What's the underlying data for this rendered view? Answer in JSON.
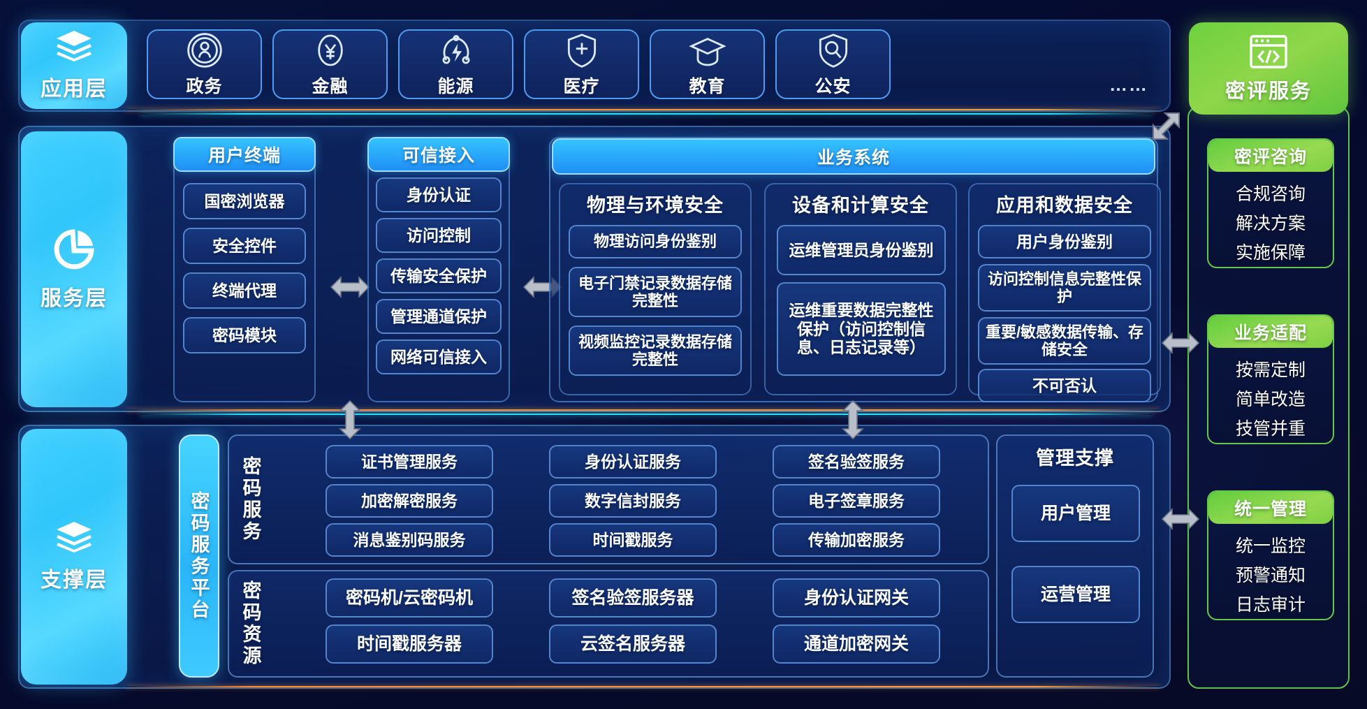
{
  "layers": {
    "application": {
      "label": "应用层",
      "icon": "layers-icon"
    },
    "service": {
      "label": "服务层",
      "icon": "pie-chart-icon"
    },
    "support": {
      "label": "支撑层",
      "icon": "layers-stack-icon"
    }
  },
  "application_layer": {
    "tiles": [
      {
        "label": "政务",
        "icon": "government-person-icon"
      },
      {
        "label": "金融",
        "icon": "finance-yuan-icon"
      },
      {
        "label": "能源",
        "icon": "energy-bolt-icon"
      },
      {
        "label": "医疗",
        "icon": "medical-shield-plus-icon"
      },
      {
        "label": "教育",
        "icon": "education-cap-icon"
      },
      {
        "label": "公安",
        "icon": "police-shield-search-icon"
      }
    ],
    "more": "……"
  },
  "service_layer": {
    "user_terminal": {
      "title": "用户终端",
      "items": [
        "国密浏览器",
        "安全控件",
        "终端代理",
        "密码模块"
      ]
    },
    "trusted_access": {
      "title": "可信接入",
      "items": [
        "身份认证",
        "访问控制",
        "传输安全保护",
        "管理通道保护",
        "网络可信接入"
      ]
    },
    "business_system": {
      "title": "业务系统",
      "columns": [
        {
          "title": "物理与环境安全",
          "items": [
            "物理访问身份鉴别",
            "电子门禁记录数据存储完整性",
            "视频监控记录数据存储完整性"
          ]
        },
        {
          "title": "设备和计算安全",
          "items": [
            "运维管理员身份鉴别",
            "运维重要数据完整性保护（访问控制信息、日志记录等）"
          ]
        },
        {
          "title": "应用和数据安全",
          "items": [
            "用户身份鉴别",
            "访问控制信息完整性保护",
            "重要/敏感数据传输、存储安全",
            "不可否认"
          ]
        }
      ]
    }
  },
  "support_layer": {
    "platform": "密码服务平台",
    "crypto_service": {
      "label": "密码服务",
      "columns": [
        [
          "证书管理服务",
          "加密解密服务",
          "消息鉴别码服务"
        ],
        [
          "身份认证服务",
          "数字信封服务",
          "时间戳服务"
        ],
        [
          "签名验签服务",
          "电子签章服务",
          "传输加密服务"
        ]
      ]
    },
    "crypto_resource": {
      "label": "密码资源",
      "columns": [
        [
          "密码机/云密码机",
          "时间戳服务器"
        ],
        [
          "签名验签服务器",
          "云签名服务器"
        ],
        [
          "身份认证网关",
          "通道加密网关"
        ]
      ]
    },
    "management_support": {
      "title": "管理支撑",
      "items": [
        "用户管理",
        "运营管理"
      ]
    }
  },
  "right_panel": {
    "header": {
      "label": "密评服务",
      "icon": "code-window-icon"
    },
    "cards": [
      {
        "title": "密评咨询",
        "items": [
          "合规咨询",
          "解决方案",
          "实施保障"
        ]
      },
      {
        "title": "业务适配",
        "items": [
          "按需定制",
          "简单改造",
          "技管并重"
        ]
      },
      {
        "title": "统一管理",
        "items": [
          "统一监控",
          "预警通知",
          "日志审计"
        ]
      }
    ]
  },
  "colors": {
    "accent_blue": "#35c3ff",
    "accent_green": "#6dd13f",
    "accent_orange": "#ff8a2a",
    "frame_border": "#5aa0f0",
    "background": "#050a30"
  }
}
